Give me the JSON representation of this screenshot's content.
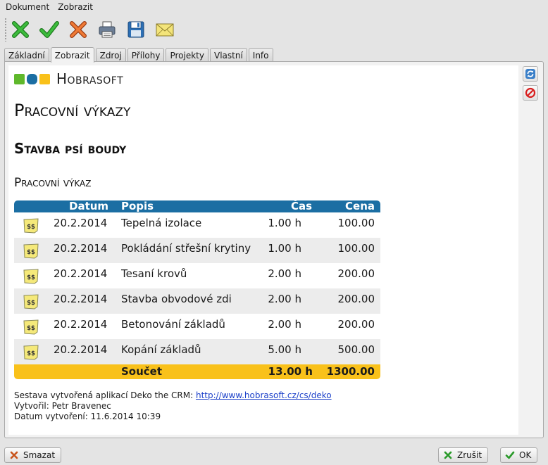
{
  "menubar": {
    "items": [
      "Dokument",
      "Zobrazit"
    ]
  },
  "toolbar": {
    "buttons": [
      {
        "icon": "cancel-x-icon",
        "color": "#2a9a2a"
      },
      {
        "icon": "check-icon",
        "color": "#2a9a2a"
      },
      {
        "icon": "delete-x-icon",
        "color": "#d35b1e"
      },
      {
        "icon": "printer-icon",
        "color": "#5a6d85"
      },
      {
        "icon": "save-disk-icon",
        "color": "#2c6fb5"
      },
      {
        "icon": "envelope-icon",
        "color": "#f0dc62"
      }
    ]
  },
  "tabs": {
    "items": [
      "Základní",
      "Zobrazit",
      "Zdroj",
      "Přílohy",
      "Projekty",
      "Vlastní",
      "Info"
    ],
    "active": "Zobrazit"
  },
  "side_buttons": [
    {
      "icon": "refresh-icon"
    },
    {
      "icon": "stop-icon"
    }
  ],
  "document": {
    "logo_colors": [
      "#5fb82b",
      "#1b6ea3",
      "#f9c11a"
    ],
    "logo_text": "Hobrasoft",
    "title": "Pracovní výkazy",
    "subtitle": "Stavba psí boudy",
    "section_title": "Pracovní výkaz",
    "table": {
      "header_color": "#1b6ea3",
      "footer_color": "#f9c11a",
      "columns": {
        "date": "Datum",
        "description": "Popis",
        "time": "Čas",
        "price": "Cena"
      },
      "rows": [
        {
          "icon": "sticky-note-dollar-icon",
          "date": "20.2.2014",
          "description": "Tepelná izolace",
          "time": "1.00 h",
          "price": "100.00"
        },
        {
          "icon": "sticky-note-dollar-icon",
          "date": "20.2.2014",
          "description": "Pokládání střešní krytiny",
          "time": "1.00 h",
          "price": "100.00"
        },
        {
          "icon": "sticky-note-dollar-icon",
          "date": "20.2.2014",
          "description": "Tesaní krovů",
          "time": "2.00 h",
          "price": "200.00"
        },
        {
          "icon": "sticky-note-dollar-icon",
          "date": "20.2.2014",
          "description": "Stavba obvodové zdi",
          "time": "2.00 h",
          "price": "200.00"
        },
        {
          "icon": "sticky-note-dollar-icon",
          "date": "20.2.2014",
          "description": "Betonování základů",
          "time": "2.00 h",
          "price": "200.00"
        },
        {
          "icon": "sticky-note-dollar-icon",
          "date": "20.2.2014",
          "description": "Kopání základů",
          "time": "5.00 h",
          "price": "500.00"
        }
      ],
      "total": {
        "label": "Součet",
        "time": "13.00 h",
        "price": "1300.00"
      }
    },
    "footer": {
      "created_by_app": "Sestava vytvořená aplikací Deko the CRM:",
      "link": "http://www.hobrasoft.cz/cs/deko",
      "author": "Vytvořil: Petr Bravenec",
      "date": "Datum vytvoření: 11.6.2014 10:39"
    }
  },
  "buttons": {
    "delete_label": "Smazat",
    "cancel_label": "Zrušit",
    "ok_label": "OK"
  }
}
